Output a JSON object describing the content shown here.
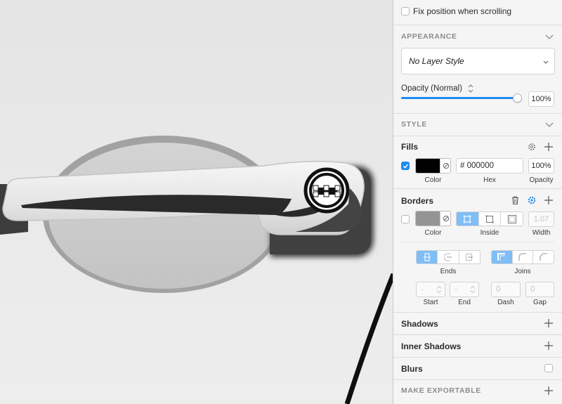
{
  "inspector": {
    "fix_position_label": "Fix position when scrolling",
    "appearance": {
      "title": "APPEARANCE",
      "layer_style": "No Layer Style",
      "opacity_label": "Opacity (Normal)",
      "opacity_value": "100%",
      "opacity_fraction": 1.0
    },
    "style": {
      "title": "STYLE"
    },
    "fills": {
      "title": "Fills",
      "enabled": true,
      "color": "#000000",
      "hex_prefix": "#",
      "hex_value": "000000",
      "opacity_value": "100%",
      "labels": {
        "color": "Color",
        "hex": "Hex",
        "opacity": "Opacity"
      }
    },
    "borders": {
      "title": "Borders",
      "enabled": false,
      "color": "#949494",
      "width_value": "1.07",
      "labels": {
        "color": "Color",
        "position": "Inside",
        "width": "Width"
      },
      "ends_label": "Ends",
      "joins_label": "Joins",
      "start_value": "-",
      "end_value": "-",
      "dash_value": "0",
      "gap_value": "0",
      "start_label": "Start",
      "end_label": "End",
      "dash_label": "Dash",
      "gap_label": "Gap"
    },
    "shadows": {
      "title": "Shadows"
    },
    "inner_shadows": {
      "title": "Inner Shadows"
    },
    "blurs": {
      "title": "Blurs"
    },
    "exportable": {
      "title": "MAKE EXPORTABLE"
    }
  },
  "colors": {
    "accent": "#1e8cf0",
    "segment_active": "#7fbef7"
  }
}
